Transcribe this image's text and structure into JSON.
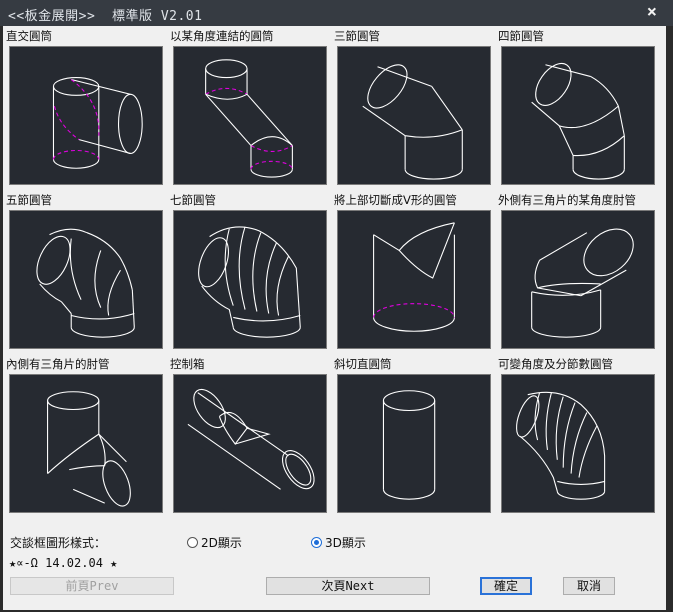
{
  "window": {
    "title_prefix": "<<板金展開>>",
    "title_edition": "標準版",
    "title_version": "V2.01",
    "close_glyph": "×"
  },
  "shapes": [
    {
      "label": "直交圓筒"
    },
    {
      "label": "以某角度連結的圓筒"
    },
    {
      "label": "三節圓管"
    },
    {
      "label": "四節圓管"
    },
    {
      "label": "五節圓管"
    },
    {
      "label": "七節圓管"
    },
    {
      "label": "將上部切斷成V形的圓管"
    },
    {
      "label": "外側有三角片的某角度肘管"
    },
    {
      "label": "內側有三角片的肘管"
    },
    {
      "label": "控制箱"
    },
    {
      "label": "斜切直圓筒"
    },
    {
      "label": "可變角度及分節數圓管"
    }
  ],
  "display_option": {
    "label": "交談框圖形樣式：",
    "options": [
      {
        "label": "2D顯示",
        "selected": false
      },
      {
        "label": "3D顯示",
        "selected": true
      }
    ]
  },
  "version_text": "★∝-Ω 14.02.04 ★",
  "buttons": {
    "prev": "前頁Prev",
    "next": "次頁Next",
    "ok": "確定",
    "cancel": "取消"
  },
  "colors": {
    "thumb_bg": "#262a31",
    "line": "#ffffff",
    "hidden_line": "#e000e0",
    "accent": "#1e6ed8"
  }
}
